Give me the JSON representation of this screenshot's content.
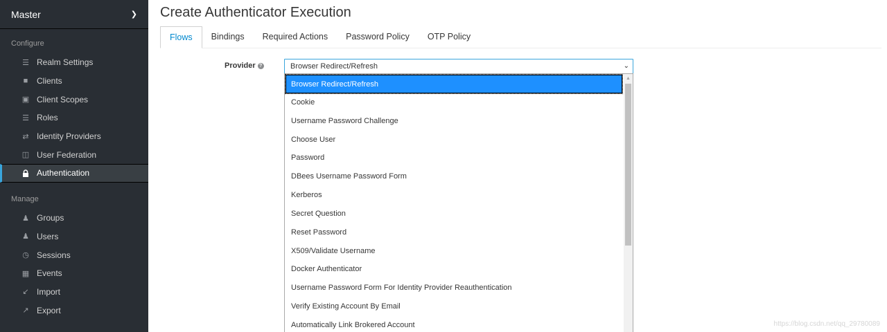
{
  "sidebar": {
    "realm": "Master",
    "configure_label": "Configure",
    "configure_items": [
      {
        "label": "Realm Settings",
        "icon": "sliders-icon"
      },
      {
        "label": "Clients",
        "icon": "cube-icon"
      },
      {
        "label": "Client Scopes",
        "icon": "cubes-icon"
      },
      {
        "label": "Roles",
        "icon": "list-icon"
      },
      {
        "label": "Identity Providers",
        "icon": "exchange-icon"
      },
      {
        "label": "User Federation",
        "icon": "database-icon"
      },
      {
        "label": "Authentication",
        "icon": "lock-icon",
        "active": true
      }
    ],
    "manage_label": "Manage",
    "manage_items": [
      {
        "label": "Groups",
        "icon": "users-icon"
      },
      {
        "label": "Users",
        "icon": "user-icon"
      },
      {
        "label": "Sessions",
        "icon": "clock-icon"
      },
      {
        "label": "Events",
        "icon": "calendar-icon"
      },
      {
        "label": "Import",
        "icon": "import-icon"
      },
      {
        "label": "Export",
        "icon": "export-icon"
      }
    ]
  },
  "main": {
    "title": "Create Authenticator Execution",
    "tabs": [
      "Flows",
      "Bindings",
      "Required Actions",
      "Password Policy",
      "OTP Policy"
    ],
    "active_tab": "Flows",
    "provider_label": "Provider",
    "provider_value": "Browser Redirect/Refresh",
    "options": [
      "Browser Redirect/Refresh",
      "Cookie",
      "Username Password Challenge",
      "Choose User",
      "Password",
      "DBees Username Password Form",
      "Kerberos",
      "Secret Question",
      "Reset Password",
      "X509/Validate Username",
      "Docker Authenticator",
      "Username Password Form For Identity Provider Reauthentication",
      "Verify Existing Account By Email",
      "Automatically Link Brokered Account"
    ]
  },
  "watermark": "https://blog.csdn.net/qq_29780089",
  "colors": {
    "sidebar_bg": "#292e34",
    "accent": "#0088ce",
    "selected_option": "#1e90ff"
  }
}
